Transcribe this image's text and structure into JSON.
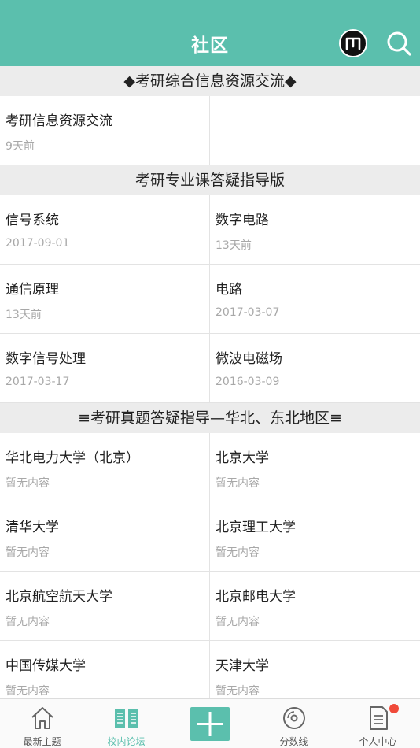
{
  "header": {
    "title": "社区",
    "m_icon": "m-logo-icon",
    "search_icon": "search-icon"
  },
  "sections": [
    {
      "title": "◆考研综合信息资源交流◆",
      "items": [
        {
          "name": "考研信息资源交流",
          "meta": "9天前"
        },
        {
          "name": "",
          "meta": ""
        }
      ]
    },
    {
      "title": "考研专业课答疑指导版",
      "items": [
        {
          "name": "信号系统",
          "meta": "2017-09-01"
        },
        {
          "name": "数字电路",
          "meta": "13天前"
        },
        {
          "name": "通信原理",
          "meta": "13天前"
        },
        {
          "name": "电路",
          "meta": "2017-03-07"
        },
        {
          "name": "数字信号处理",
          "meta": "2017-03-17"
        },
        {
          "name": "微波电磁场",
          "meta": "2016-03-09"
        }
      ]
    },
    {
      "title": "≡考研真题答疑指导—华北、东北地区≡",
      "items": [
        {
          "name": "华北电力大学（北京）",
          "meta": "暂无内容"
        },
        {
          "name": "北京大学",
          "meta": "暂无内容"
        },
        {
          "name": "清华大学",
          "meta": "暂无内容"
        },
        {
          "name": "北京理工大学",
          "meta": "暂无内容"
        },
        {
          "name": "北京航空航天大学",
          "meta": "暂无内容"
        },
        {
          "name": "北京邮电大学",
          "meta": "暂无内容"
        },
        {
          "name": "中国传媒大学",
          "meta": "暂无内容"
        },
        {
          "name": " 天津大学",
          "meta": "暂无内容"
        }
      ]
    }
  ],
  "tabbar": {
    "tabs": [
      {
        "label": "最新主题",
        "icon": "home-icon"
      },
      {
        "label": "校内论坛",
        "icon": "open-book-icon"
      },
      {
        "label": "",
        "icon": "add-icon"
      },
      {
        "label": "分数线",
        "icon": "disc-icon"
      },
      {
        "label": "个人中心",
        "icon": "document-icon"
      }
    ],
    "active_index": 1
  },
  "colors": {
    "brand": "#5bbfad",
    "badge": "#f04a3a",
    "section_bg": "#ececec",
    "meta_text": "#a8a8a8"
  }
}
